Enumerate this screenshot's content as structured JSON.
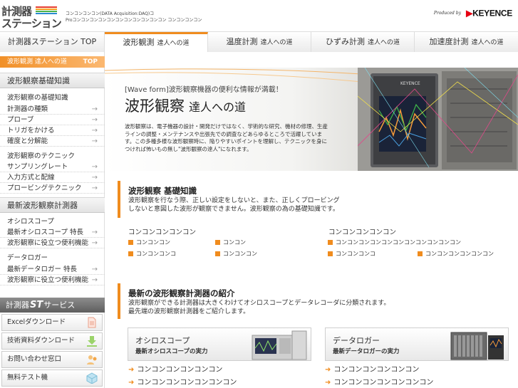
{
  "header": {
    "logo_line1": "計測器",
    "logo_line2": "ステーション",
    "tagline_line1": "コンコンコンコン(DATA Acquisition:DAQ)コ",
    "tagline_line2": "Proコンコンコンコンコンコンコンコンコンコンコン コンコンコンコン",
    "produced_by": "Produced by",
    "brand": "KEYENCE",
    "brand_color": "#e60012"
  },
  "nav": {
    "tabs": [
      {
        "label": "計測器ステーション TOP",
        "sub": "",
        "active": false
      },
      {
        "label": "波形観測",
        "sub": "達人への道",
        "active": true
      },
      {
        "label": "温度計測",
        "sub": "達人への道",
        "active": false
      },
      {
        "label": "ひずみ計測",
        "sub": "達人への道",
        "active": false
      },
      {
        "label": "加速度計測",
        "sub": "達人への道",
        "active": false
      }
    ]
  },
  "breadcrumb": {
    "label": "波形観測 達人への道",
    "top": "TOP"
  },
  "sidebar": {
    "basics_title": "波形観察基礎知識",
    "basics_group": "波形観察の基礎知識",
    "basics_items": [
      "計測器の種類",
      "プローブ",
      "トリガをかける",
      "確度と分解能"
    ],
    "tech_group": "波形観察のテクニック",
    "tech_items": [
      "サンプリングレート",
      "入力方式と配線",
      "プロービングテクニック"
    ],
    "latest_title": "最新波形観察計測器",
    "osc_group": "オシロスコープ",
    "osc_items": [
      "最新オシロスコープ 特長",
      "波形観察に役立つ便利機能"
    ],
    "logger_group": "データロガー",
    "logger_items": [
      "最新データロガー 特長",
      "波形観察に役立つ便利機能"
    ],
    "service_prefix": "計測器",
    "service_st": "ST",
    "service_suffix": "サービス",
    "service_buttons": [
      "Excelダウンロード",
      "技術資料ダウンロード",
      "お問い合わせ窓口",
      "無料テスト機"
    ]
  },
  "hero": {
    "kicker": "[Wave form]波形観察機器の便利な情報が満載！",
    "title": "波形観察",
    "title_sub": "達人への道",
    "desc": "波形観察は、電子機器の設計・開発だけではなく、学術的な研究、機材の修理、生産ラインの調整・メンテナンスや出張先での調査などあらゆるところで活躍しています。この多種多様な波形観察時に、陥りやすいポイントを理解し、テクニックを身につければ怖いもの無し\"波形観察の達人\"になれます。",
    "brand_on_device": "KEYENCE"
  },
  "basics": {
    "heading": "波形観察 基礎知識",
    "text_line1": "波形観察を行なう際、正しい設定をしないと、また、正しくプロービング",
    "text_line2": "しないと意図した波形が観察できません。波形観察の為の基礎知識です。",
    "group1_title": "コンコンコンコンコン",
    "group1_links": [
      "コンコンコン",
      "コンコン",
      "コンコンコンコ",
      "コンコンコン"
    ],
    "group2_title": "コンコンコンコンコン",
    "group2_links": [
      "コンコンコンコンコンコンコンコンコンコンコン",
      "コンコンコンコ",
      "コンコンコンコンコンコン"
    ]
  },
  "latest": {
    "heading": "最新の波形観察計測器の紹介",
    "text_line1": "波形観察ができる計測器は大きくわけてオシロスコープとデータレコーダに分類されます。",
    "text_line2": "最先端の波形観察計測器をご紹介します。",
    "cards": [
      {
        "title": "オシロスコープ",
        "subtitle": "最新オシロスコープの実力",
        "links": [
          "コンコンコンコンコンコン",
          "コンコンコンコンコンコンコン"
        ]
      },
      {
        "title": "データロガー",
        "subtitle": "最新データロガーの実力",
        "links": [
          "コンコンコンコンコンコン",
          "コンコンコンコンコンコンコン"
        ]
      }
    ]
  },
  "colors": {
    "accent": "#f08c1e",
    "brand_red": "#e60012"
  }
}
